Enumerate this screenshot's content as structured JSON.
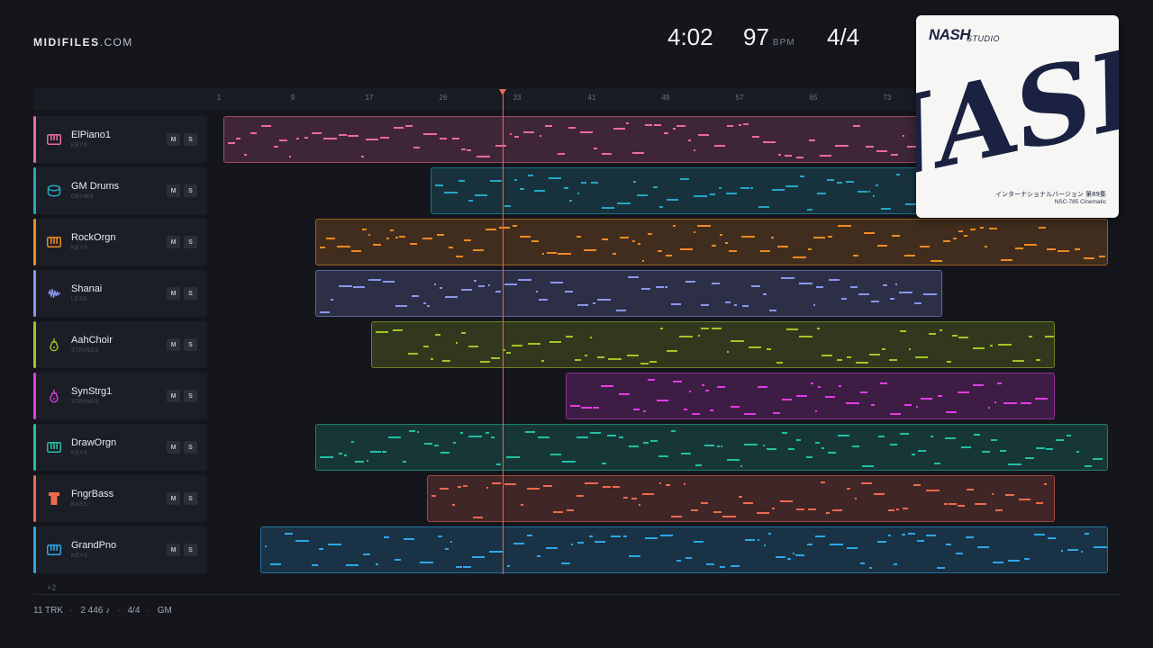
{
  "brand": {
    "name": "MIDIFILES",
    "domain": ".COM"
  },
  "transport": {
    "time": "4:02",
    "bpm": "97",
    "bpm_unit": "BPM",
    "signature": "4/4"
  },
  "ruler": {
    "bars": [
      "1",
      "9",
      "17",
      "26",
      "33",
      "41",
      "49",
      "57",
      "65",
      "73"
    ]
  },
  "tracks": [
    {
      "name": "ElPiano1",
      "category": "KEYS",
      "icon": "piano-keys-icon",
      "color": "#ec6aa0",
      "mute": "M",
      "solo": "S"
    },
    {
      "name": "GM Drums",
      "category": "DRUMS",
      "icon": "drum-icon",
      "color": "#26a6c4",
      "mute": "M",
      "solo": "S"
    },
    {
      "name": "RockOrgn",
      "category": "KEYS",
      "icon": "organ-keys-icon",
      "color": "#ee8a22",
      "mute": "M",
      "solo": "S"
    },
    {
      "name": "Shanai",
      "category": "LEAD",
      "icon": "waveform-icon",
      "color": "#8a96ee",
      "mute": "M",
      "solo": "S"
    },
    {
      "name": "AahChoir",
      "category": "STRINGS",
      "icon": "choir-instrument-icon",
      "color": "#a6c326",
      "mute": "M",
      "solo": "S"
    },
    {
      "name": "SynStrg1",
      "category": "STRINGS",
      "icon": "string-instrument-icon",
      "color": "#e23ce6",
      "mute": "M",
      "solo": "S"
    },
    {
      "name": "DrawOrgn",
      "category": "KEYS",
      "icon": "organ-keys-icon",
      "color": "#22bfa3",
      "mute": "M",
      "solo": "S"
    },
    {
      "name": "FngrBass",
      "category": "BASS",
      "icon": "bass-amp-icon",
      "color": "#ee6a4e",
      "mute": "M",
      "solo": "S"
    },
    {
      "name": "GrandPno",
      "category": "KEYS",
      "icon": "piano-keys-icon",
      "color": "#2ea6ea",
      "mute": "M",
      "solo": "S"
    }
  ],
  "more_tracks": "+2",
  "footer": {
    "tracks": "11 TRK",
    "notes": "2 446 ♪",
    "signature": "4/4",
    "standard": "GM"
  },
  "album": {
    "logo": "NASH",
    "logo_sub": "STUDIO",
    "big_text": "NASH",
    "subtitle": "インターナショナルバージョン 第89集",
    "catalog": "NSC-785  Cinematic"
  }
}
